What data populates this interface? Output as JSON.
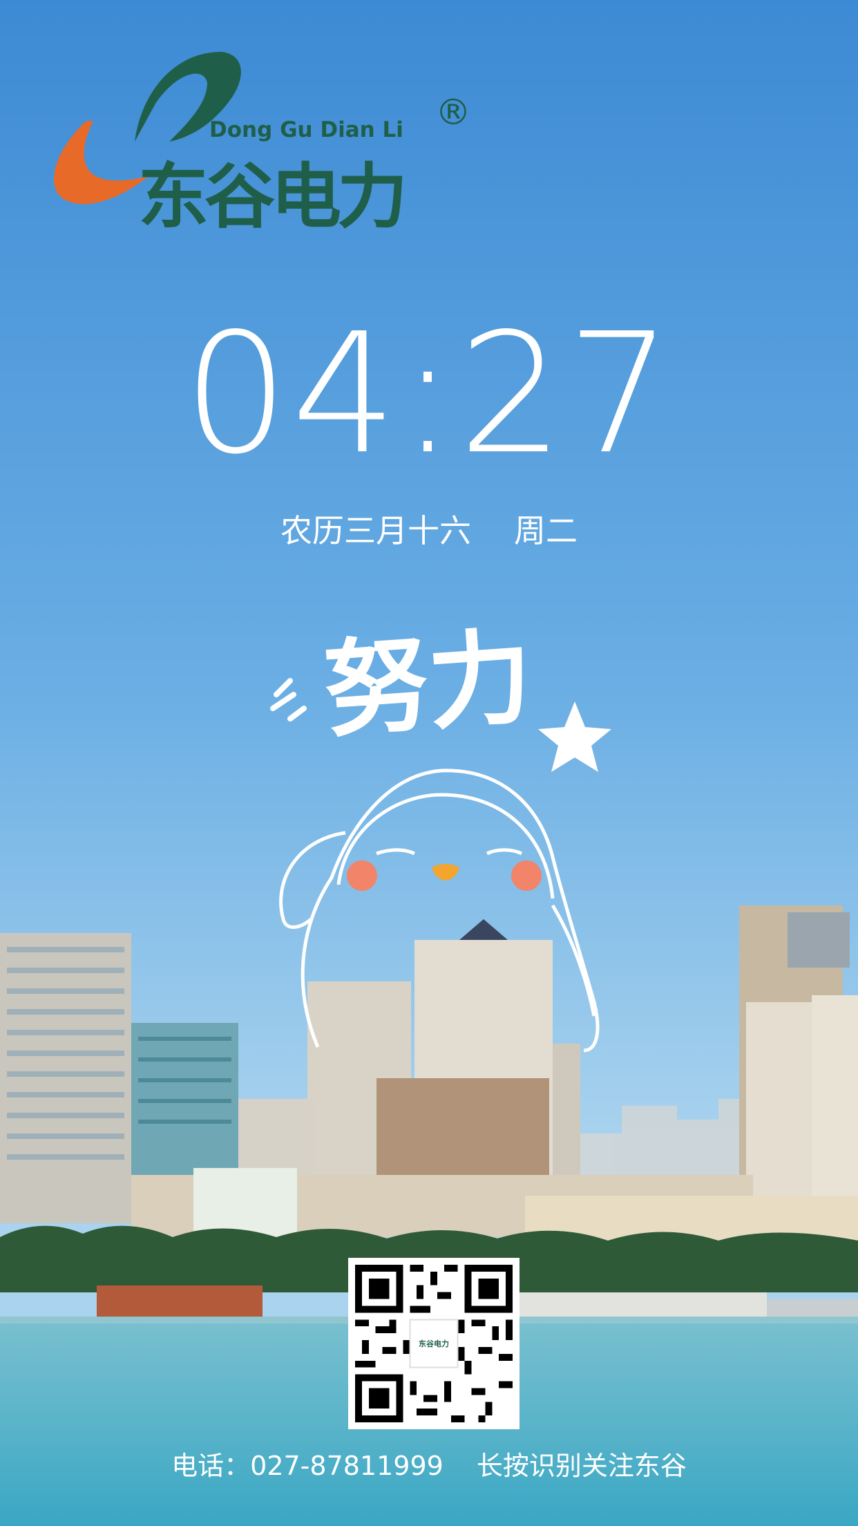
{
  "brand": {
    "name_en": "Dong Gu Dian Li",
    "name_cn": "东谷电力",
    "registered_mark": "®",
    "colors": {
      "green": "#1f5f4a",
      "orange": "#e86a28"
    }
  },
  "clock": {
    "time": "04:27"
  },
  "date": {
    "lunar": "农历三月十六",
    "weekday": "周二"
  },
  "slogan": {
    "text": "努力"
  },
  "qr": {
    "center_logo_text": "东谷电力"
  },
  "footer": {
    "phone_text": "电话：027-87811999",
    "follow_text": "长按识别关注东谷"
  },
  "colors": {
    "sky_top": "#4a94d8",
    "sky_bottom": "#a9d3ee",
    "water": "#4fb1c8",
    "cheek": "#f2846a",
    "beak": "#f3a52d"
  }
}
